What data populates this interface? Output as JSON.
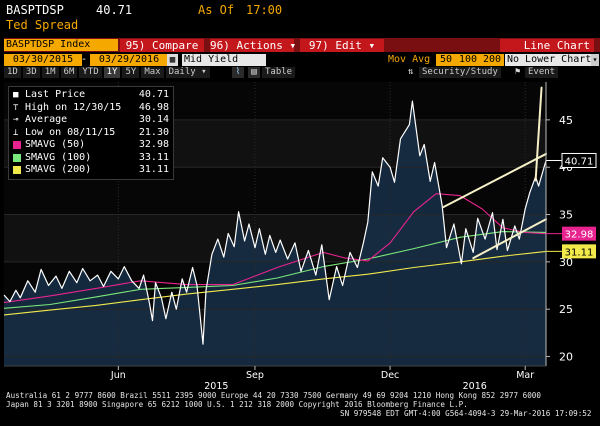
{
  "header": {
    "ticker": "BASPTDSP",
    "price": "40.71",
    "as_of": "As Of",
    "time": "17:00",
    "name": "Ted Spread"
  },
  "toolbar": {
    "index_field": "BASPTDSP Index",
    "compare": "95) Compare",
    "actions": "96) Actions ▾",
    "edit": "97) Edit ▾",
    "chart_type": "Line Chart",
    "start_date": "03/30/2015",
    "end_date": "03/29/2016",
    "field": "Mid Yield",
    "mov_avg_label": "Mov Avg",
    "mov_avg_values": [
      "50",
      "100",
      "200"
    ],
    "lower_chart": "No Lower Chart",
    "security_study": "Security/Study",
    "event": "Event"
  },
  "periods": {
    "items": [
      "1D",
      "3D",
      "1M",
      "6M",
      "YTD",
      "1Y",
      "5Y",
      "Max"
    ],
    "selected": "1Y",
    "frequency": "Daily ▾",
    "table": "Table"
  },
  "legend": {
    "items": [
      {
        "label": "Last Price",
        "value": "40.71",
        "icon": "white-square",
        "color": "#ffffff"
      },
      {
        "label": "High on 12/30/15",
        "value": "46.98",
        "icon": "high-marker",
        "color": "#ffffff"
      },
      {
        "label": "Average",
        "value": "30.14",
        "icon": "average-marker",
        "color": "#ffffff"
      },
      {
        "label": "Low on 08/11/15",
        "value": "21.30",
        "icon": "low-marker",
        "color": "#ffffff"
      },
      {
        "label": "SMAVG (50)",
        "value": "32.98",
        "icon": "color-swatch",
        "color": "#e8238f"
      },
      {
        "label": "SMAVG (100)",
        "value": "33.11",
        "icon": "color-swatch",
        "color": "#7be87b"
      },
      {
        "label": "SMAVG (200)",
        "value": "31.11",
        "icon": "color-swatch",
        "color": "#f2ea4a"
      }
    ]
  },
  "footer": {
    "line1": "Australia 61 2 9777 8600 Brazil 5511 2395 9000 Europe 44 20 7330 7500 Germany 49 69 9204 1210 Hong Kong 852 2977 6000",
    "line2": "Japan 81 3 3201 8900          Singapore 65 6212 1000          U.S. 1 212 318 2000          Copyright 2016 Bloomberg Finance L.P.",
    "line3": "SN 979548 EDT  GMT-4:00 G564-4094-3 29-Mar-2016 17:09:52"
  },
  "chart_data": {
    "type": "line",
    "y_range": [
      19,
      49
    ],
    "y_ticks": [
      20,
      25,
      30,
      35,
      40,
      45
    ],
    "x_labels": [
      {
        "label": "Jun",
        "date": "2015-06-15"
      },
      {
        "label": "Sep",
        "date": "2015-09-15"
      },
      {
        "label": "Dec",
        "date": "2015-12-15"
      },
      {
        "label": "Mar",
        "date": "2016-03-15"
      }
    ],
    "year_labels": [
      {
        "label": "2015",
        "date": "2015-08-20"
      },
      {
        "label": "2016",
        "date": "2016-02-10"
      }
    ],
    "last_price_label": "40.71",
    "sma50_label": "32.98",
    "sma200_label": "31.11",
    "series": [
      {
        "name": "Last Price",
        "color": "#ffffff",
        "points": [
          [
            "2015-03-30",
            26.5
          ],
          [
            "2015-04-03",
            25.8
          ],
          [
            "2015-04-07",
            27.0
          ],
          [
            "2015-04-10",
            26.2
          ],
          [
            "2015-04-15",
            28.0
          ],
          [
            "2015-04-20",
            26.8
          ],
          [
            "2015-04-24",
            29.2
          ],
          [
            "2015-04-29",
            27.5
          ],
          [
            "2015-05-04",
            28.5
          ],
          [
            "2015-05-08",
            27.2
          ],
          [
            "2015-05-13",
            29.0
          ],
          [
            "2015-05-18",
            27.8
          ],
          [
            "2015-05-22",
            29.3
          ],
          [
            "2015-05-27",
            28.0
          ],
          [
            "2015-06-01",
            28.6
          ],
          [
            "2015-06-05",
            27.4
          ],
          [
            "2015-06-10",
            29.0
          ],
          [
            "2015-06-15",
            28.2
          ],
          [
            "2015-06-19",
            29.5
          ],
          [
            "2015-06-24",
            28.0
          ],
          [
            "2015-06-29",
            27.2
          ],
          [
            "2015-07-02",
            28.6
          ],
          [
            "2015-07-06",
            25.6
          ],
          [
            "2015-07-08",
            23.8
          ],
          [
            "2015-07-10",
            27.8
          ],
          [
            "2015-07-14",
            26.2
          ],
          [
            "2015-07-17",
            24.0
          ],
          [
            "2015-07-21",
            26.8
          ],
          [
            "2015-07-24",
            25.0
          ],
          [
            "2015-07-28",
            28.2
          ],
          [
            "2015-07-31",
            26.8
          ],
          [
            "2015-08-04",
            29.4
          ],
          [
            "2015-08-07",
            27.5
          ],
          [
            "2015-08-11",
            21.3
          ],
          [
            "2015-08-13",
            27.0
          ],
          [
            "2015-08-17",
            30.8
          ],
          [
            "2015-08-21",
            32.4
          ],
          [
            "2015-08-25",
            30.5
          ],
          [
            "2015-08-28",
            33.0
          ],
          [
            "2015-09-01",
            31.6
          ],
          [
            "2015-09-04",
            35.3
          ],
          [
            "2015-09-08",
            32.2
          ],
          [
            "2015-09-11",
            34.0
          ],
          [
            "2015-09-15",
            31.5
          ],
          [
            "2015-09-18",
            33.5
          ],
          [
            "2015-09-22",
            30.8
          ],
          [
            "2015-09-25",
            32.8
          ],
          [
            "2015-09-29",
            31.0
          ],
          [
            "2015-10-02",
            32.3
          ],
          [
            "2015-10-07",
            30.3
          ],
          [
            "2015-10-12",
            32.0
          ],
          [
            "2015-10-16",
            29.0
          ],
          [
            "2015-10-21",
            31.2
          ],
          [
            "2015-10-26",
            28.6
          ],
          [
            "2015-10-30",
            31.8
          ],
          [
            "2015-11-04",
            26.0
          ],
          [
            "2015-11-09",
            29.5
          ],
          [
            "2015-11-13",
            27.5
          ],
          [
            "2015-11-18",
            31.0
          ],
          [
            "2015-11-23",
            29.4
          ],
          [
            "2015-11-27",
            32.0
          ],
          [
            "2015-11-30",
            34.2
          ],
          [
            "2015-12-03",
            39.5
          ],
          [
            "2015-12-07",
            38.0
          ],
          [
            "2015-12-10",
            41.0
          ],
          [
            "2015-12-15",
            40.0
          ],
          [
            "2015-12-18",
            38.4
          ],
          [
            "2015-12-22",
            43.0
          ],
          [
            "2015-12-28",
            44.5
          ],
          [
            "2015-12-30",
            46.98
          ],
          [
            "2016-01-04",
            41.2
          ],
          [
            "2016-01-07",
            42.4
          ],
          [
            "2016-01-11",
            38.5
          ],
          [
            "2016-01-14",
            40.5
          ],
          [
            "2016-01-19",
            36.0
          ],
          [
            "2016-01-22",
            31.5
          ],
          [
            "2016-01-27",
            34.0
          ],
          [
            "2016-02-01",
            29.8
          ],
          [
            "2016-02-04",
            33.5
          ],
          [
            "2016-02-09",
            31.0
          ],
          [
            "2016-02-12",
            34.6
          ],
          [
            "2016-02-17",
            32.4
          ],
          [
            "2016-02-22",
            35.2
          ],
          [
            "2016-02-25",
            31.3
          ],
          [
            "2016-02-29",
            34.5
          ],
          [
            "2016-03-03",
            31.2
          ],
          [
            "2016-03-08",
            33.8
          ],
          [
            "2016-03-11",
            32.4
          ],
          [
            "2016-03-15",
            35.6
          ],
          [
            "2016-03-18",
            37.3
          ],
          [
            "2016-03-22",
            39.0
          ],
          [
            "2016-03-24",
            38.0
          ],
          [
            "2016-03-29",
            40.71
          ]
        ]
      },
      {
        "name": "SMAVG (50)",
        "color": "#e8238f",
        "points": [
          [
            "2015-03-30",
            25.7
          ],
          [
            "2015-04-30",
            26.4
          ],
          [
            "2015-05-31",
            27.2
          ],
          [
            "2015-06-30",
            28.0
          ],
          [
            "2015-07-31",
            27.6
          ],
          [
            "2015-08-31",
            27.6
          ],
          [
            "2015-09-30",
            29.4
          ],
          [
            "2015-10-31",
            31.0
          ],
          [
            "2015-11-15",
            30.4
          ],
          [
            "2015-11-30",
            30.1
          ],
          [
            "2015-12-15",
            32.0
          ],
          [
            "2015-12-31",
            35.3
          ],
          [
            "2016-01-15",
            37.2
          ],
          [
            "2016-01-31",
            37.0
          ],
          [
            "2016-02-15",
            35.6
          ],
          [
            "2016-02-29",
            33.6
          ],
          [
            "2016-03-15",
            33.1
          ],
          [
            "2016-03-29",
            32.98
          ]
        ]
      },
      {
        "name": "SMAVG (100)",
        "color": "#7be87b",
        "points": [
          [
            "2015-03-30",
            25.1
          ],
          [
            "2015-04-30",
            25.5
          ],
          [
            "2015-05-31",
            26.3
          ],
          [
            "2015-06-30",
            27.1
          ],
          [
            "2015-07-31",
            27.3
          ],
          [
            "2015-08-31",
            27.5
          ],
          [
            "2015-09-30",
            28.3
          ],
          [
            "2015-10-31",
            29.5
          ],
          [
            "2015-11-30",
            30.3
          ],
          [
            "2015-12-31",
            31.4
          ],
          [
            "2016-01-31",
            32.6
          ],
          [
            "2016-02-29",
            33.2
          ],
          [
            "2016-03-29",
            33.11
          ]
        ]
      },
      {
        "name": "SMAVG (200)",
        "color": "#f2ea4a",
        "points": [
          [
            "2015-03-30",
            24.4
          ],
          [
            "2015-04-30",
            24.9
          ],
          [
            "2015-05-31",
            25.4
          ],
          [
            "2015-06-30",
            26.0
          ],
          [
            "2015-07-31",
            26.6
          ],
          [
            "2015-08-31",
            27.1
          ],
          [
            "2015-09-30",
            27.6
          ],
          [
            "2015-10-31",
            28.2
          ],
          [
            "2015-11-30",
            28.7
          ],
          [
            "2015-12-31",
            29.4
          ],
          [
            "2016-01-31",
            30.0
          ],
          [
            "2016-02-29",
            30.6
          ],
          [
            "2016-03-29",
            31.11
          ]
        ]
      }
    ],
    "annotations": [
      {
        "name": "upper-trendline",
        "color": "#f5f0c8",
        "points": [
          [
            "2016-01-20",
            35.8
          ],
          [
            "2016-03-29",
            41.4
          ]
        ]
      },
      {
        "name": "lower-trendline",
        "color": "#f5f0c8",
        "points": [
          [
            "2016-02-09",
            30.4
          ],
          [
            "2016-03-29",
            34.5
          ]
        ]
      },
      {
        "name": "breakout-arrow",
        "color": "#f5f0c8",
        "points": [
          [
            "2016-03-22",
            38.6
          ],
          [
            "2016-03-26",
            48.4
          ]
        ]
      }
    ]
  }
}
